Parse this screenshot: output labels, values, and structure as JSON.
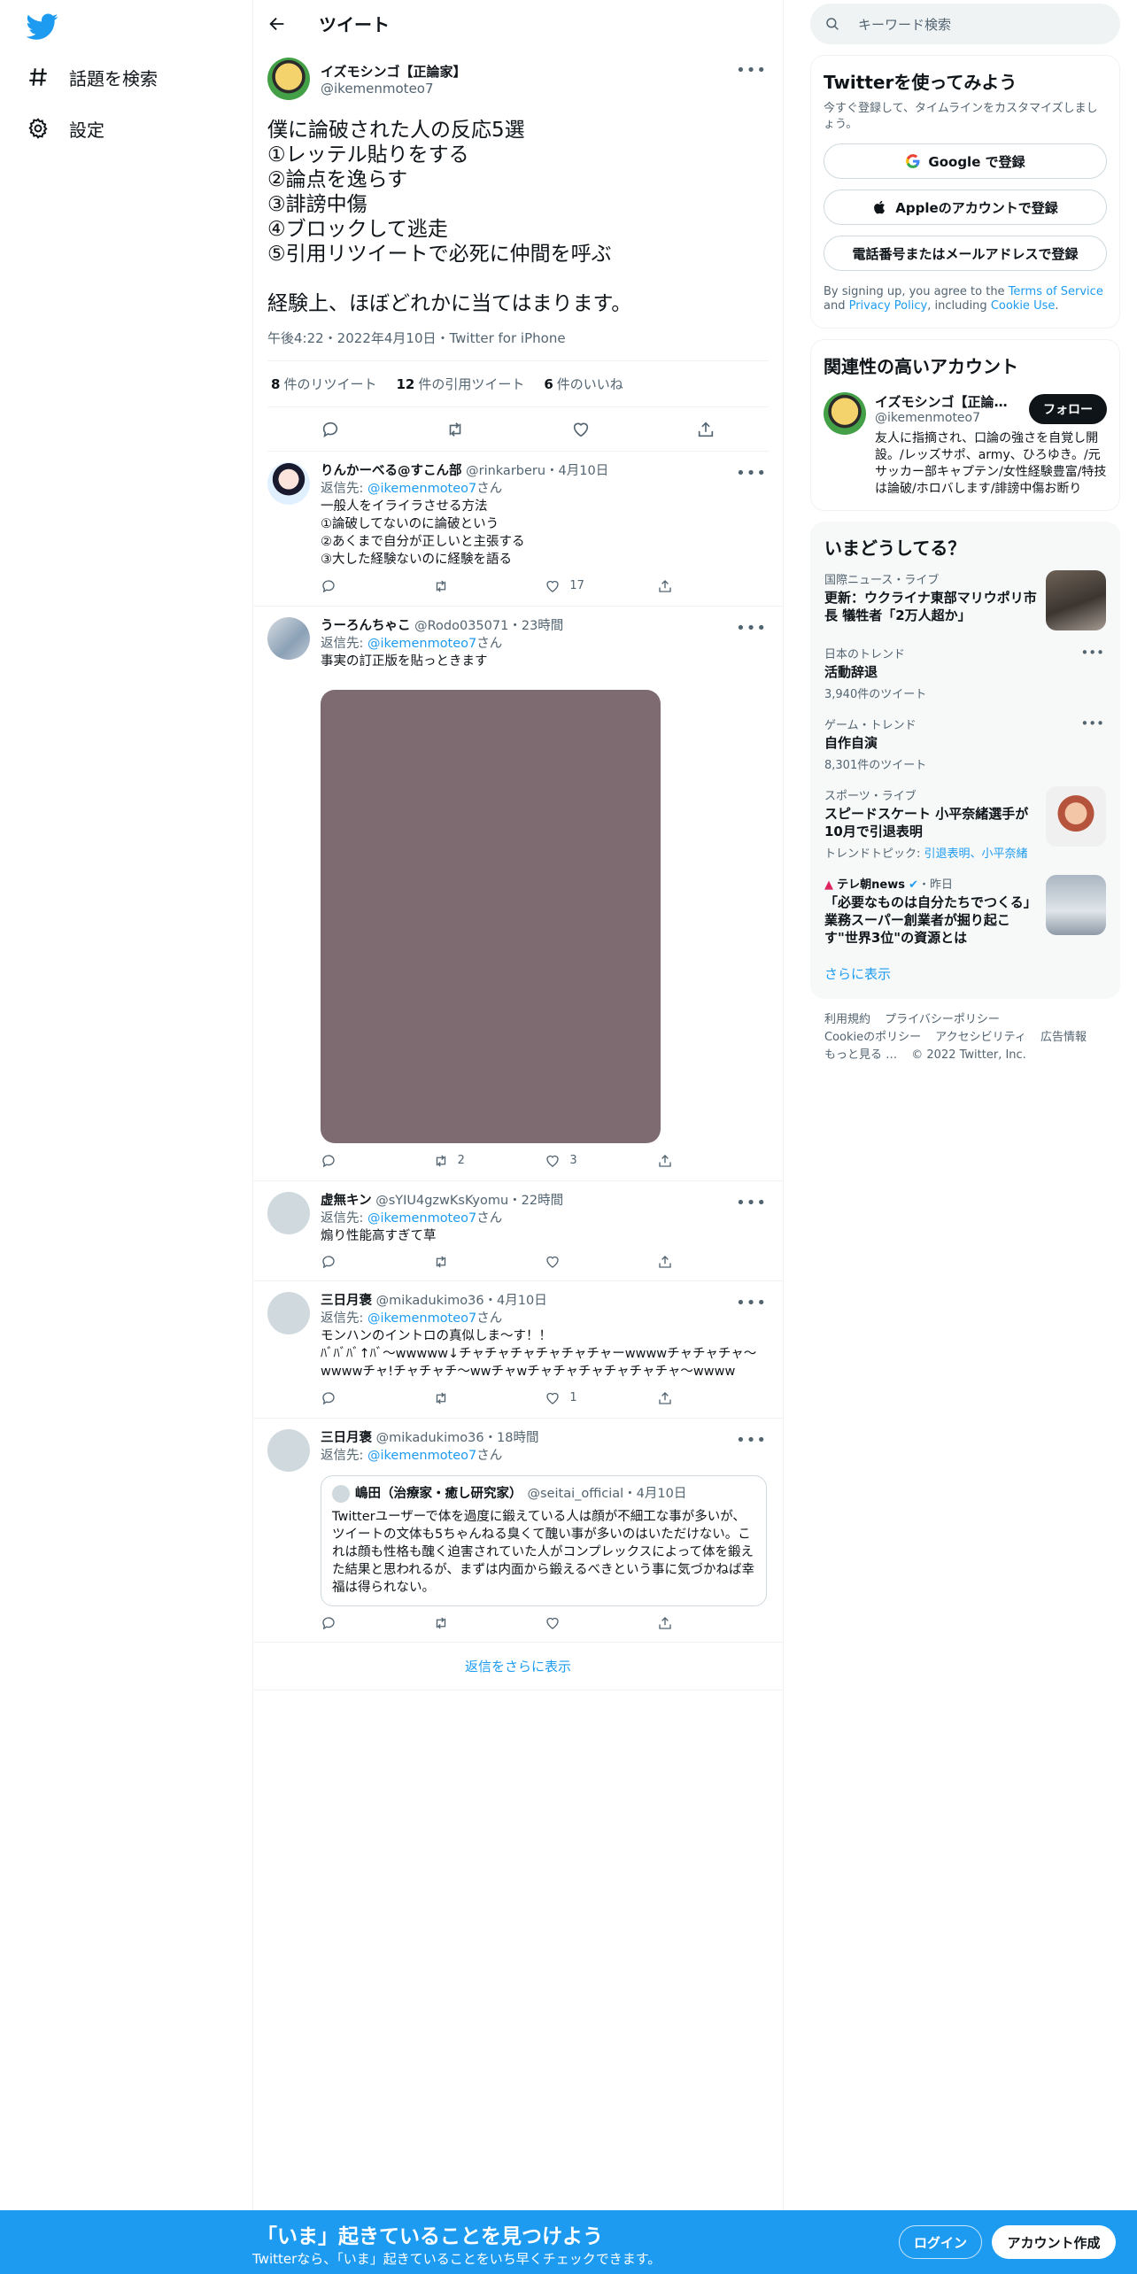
{
  "colors": {
    "accent": "#1d9bf0",
    "text": "#0f1419",
    "muted": "#536471"
  },
  "nav": {
    "explore": "話題を検索",
    "settings": "設定"
  },
  "header": {
    "title": "ツイート"
  },
  "focus": {
    "name": "イズモシンゴ【正論家】",
    "handle": "@ikemenmoteo7",
    "text": "僕に論破された人の反応5選\n①レッテル貼りをする\n②論点を逸らす\n③誹謗中傷\n④ブロックして逃走\n⑤引用リツイートで必死に仲間を呼ぶ\n\n経験上、ほぼどれかに当てはまります。",
    "meta": "午後4:22・2022年4月10日・Twitter for iPhone",
    "stats": {
      "rt_count": "8",
      "rt_label": "件のリツイート",
      "quote_count": "12",
      "quote_label": "件の引用ツイート",
      "like_count": "6",
      "like_label": "件のいいね"
    }
  },
  "replies": [
    {
      "name": "りんかーべる@すこん部",
      "handle": "@rinkarberu",
      "time": "・4月10日",
      "reply_prefix": "返信先: ",
      "reply_to": "@ikemenmoteo7",
      "reply_suffix": "さん",
      "text": "一般人をイライラさせる方法\n①論破してないのに論破という\n②あくまで自分が正しいと主張する\n③大した経験ないのに経験を語る",
      "retweets": "",
      "likes": "17"
    },
    {
      "name": "うーろんちゃこ",
      "handle": "@Rodo035071",
      "time": "・23時間",
      "reply_prefix": "返信先: ",
      "reply_to": "@ikemenmoteo7",
      "reply_suffix": "さん",
      "text": "事実の訂正版を貼っときます",
      "retweets": "2",
      "likes": "3"
    },
    {
      "name": "虚無キン",
      "handle": "@sYIU4gzwKsKyomu",
      "time": "・22時間",
      "reply_prefix": "返信先: ",
      "reply_to": "@ikemenmoteo7",
      "reply_suffix": "さん",
      "text": "煽り性能高すぎて草",
      "retweets": "",
      "likes": ""
    },
    {
      "name": "三日月褒",
      "handle": "@mikadukimo36",
      "time": "・4月10日",
      "reply_prefix": "返信先: ",
      "reply_to": "@ikemenmoteo7",
      "reply_suffix": "さん",
      "text": "モンハンのイントロの真似しま〜す！！\nﾊﾞﾊﾞﾊﾞ↑ﾊﾞ〜wwwww↓チャチャチャチャチャチャーwwwwチャチャチャ〜wwwwチャ!チャチャチ〜wwチャwチャチャチャチャチャチャ〜wwww",
      "retweets": "",
      "likes": "1"
    },
    {
      "name": "三日月褒",
      "handle": "@mikadukimo36",
      "time": "・18時間",
      "reply_prefix": "返信先: ",
      "reply_to": "@ikemenmoteo7",
      "reply_suffix": "さん",
      "quote": {
        "name": "嶋田（治療家・癒し研究家）",
        "handle": "@seitai_official",
        "time": "・4月10日",
        "text": "Twitterユーザーで体を過度に鍛えている人は顔が不細工な事が多いが、ツイートの文体も5ちゃんねる臭くて醜い事が多いのはいただけない。これは顔も性格も醜く迫害されていた人がコンプレックスによって体を鍛えた結果と思われるが、まずは内面から鍛えるべきという事に気づかねば幸福は得られない。"
      },
      "retweets": "",
      "likes": ""
    }
  ],
  "show_more_replies": "返信をさらに表示",
  "right": {
    "search_placeholder": "キーワード検索",
    "signup": {
      "title": "Twitterを使ってみよう",
      "sub": "今すぐ登録して、タイムラインをカスタマイズしましょう。",
      "google": "Google で登録",
      "apple": "Appleのアカウントで登録",
      "phone": "電話番号またはメールアドレスで登録",
      "terms_pre": "By signing up, you agree to the ",
      "terms_tos": "Terms of Service",
      "terms_and": " and ",
      "terms_pp": "Privacy Policy",
      "terms_incl": ", including ",
      "terms_cookie": "Cookie Use",
      "terms_end": "."
    },
    "related": {
      "title": "関連性の高いアカウント",
      "name": "イズモシンゴ【正論家】",
      "handle": "@ikemenmoteo7",
      "follow": "フォロー",
      "bio": "友人に指摘され、口論の強さを自覚し開設。/レッズサポ、army、ひろゆき。/元サッカー部キャプテン/女性経験豊富/特技は論破/ホロバします/誹謗中傷お断り"
    },
    "trends": {
      "title": "いまどうしてる？",
      "items": [
        {
          "meta": "国際ニュース・ライブ",
          "title": "更新：ウクライナ東部マリウポリ市長 犠牲者「2万人超か」"
        },
        {
          "meta": "日本のトレンド",
          "title": "活動辞退",
          "count": "3,940件のツイート"
        },
        {
          "meta": "ゲーム・トレンド",
          "title": "自作自演",
          "count": "8,301件のツイート"
        },
        {
          "meta": "スポーツ・ライブ",
          "title": "スピードスケート 小平奈緒選手が10月で引退表明",
          "topic_prefix": "トレンドトピック: ",
          "topic_1": "引退表明",
          "topic_sep": "、",
          "topic_2": "小平奈緒"
        },
        {
          "source": "テレ朝news",
          "time": "・昨日",
          "title": "「必要なものは自分たちでつくる」 業務スーパー創業者が掘り起こす\"世界3位\"の資源とは"
        }
      ],
      "show_more": "さらに表示"
    },
    "footer": {
      "terms": "利用規約",
      "privacy": "プライバシーポリシー",
      "cookie": "Cookieのポリシー",
      "accessibility": "アクセシビリティ",
      "ads": "広告情報",
      "more": "もっと見る …",
      "copyright": "© 2022 Twitter, Inc."
    }
  },
  "bottombar": {
    "title": "「いま」起きていることを見つけよう",
    "sub": "Twitterなら、「いま」起きていることをいち早くチェックできます。",
    "login": "ログイン",
    "signup": "アカウント作成"
  }
}
